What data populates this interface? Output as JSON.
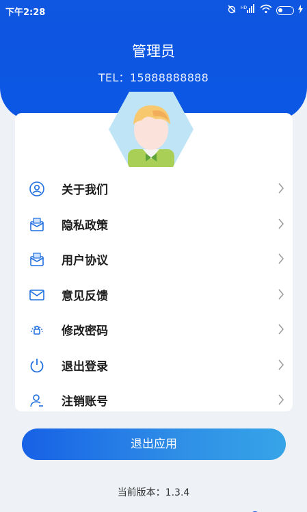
{
  "status_bar": {
    "time": "下午2:28",
    "icons": [
      "alarm-off-icon",
      "hd-signal-icon",
      "wifi-icon",
      "battery-icon",
      "charging-icon"
    ]
  },
  "header": {
    "title": "管理员",
    "phone": "TEL：15888888888",
    "bg_color": "#0b57e4"
  },
  "avatar": {
    "icon": "user-avatar-icon"
  },
  "menu": {
    "items": [
      {
        "label": "关于我们",
        "icon": "about-user-icon"
      },
      {
        "label": "隐私政策",
        "icon": "privacy-envelope-icon"
      },
      {
        "label": "用户协议",
        "icon": "agreement-envelope-icon"
      },
      {
        "label": "意见反馈",
        "icon": "mail-icon"
      },
      {
        "label": "修改密码",
        "icon": "lock-icon"
      },
      {
        "label": "退出登录",
        "icon": "power-icon"
      },
      {
        "label": "注销账号",
        "icon": "user-remove-icon"
      }
    ]
  },
  "exit_button": {
    "label": "退出应用"
  },
  "version": {
    "text": "当前版本：1.3.4"
  },
  "colors": {
    "accent": "#1761e6",
    "icon": "#1f6fe0"
  }
}
